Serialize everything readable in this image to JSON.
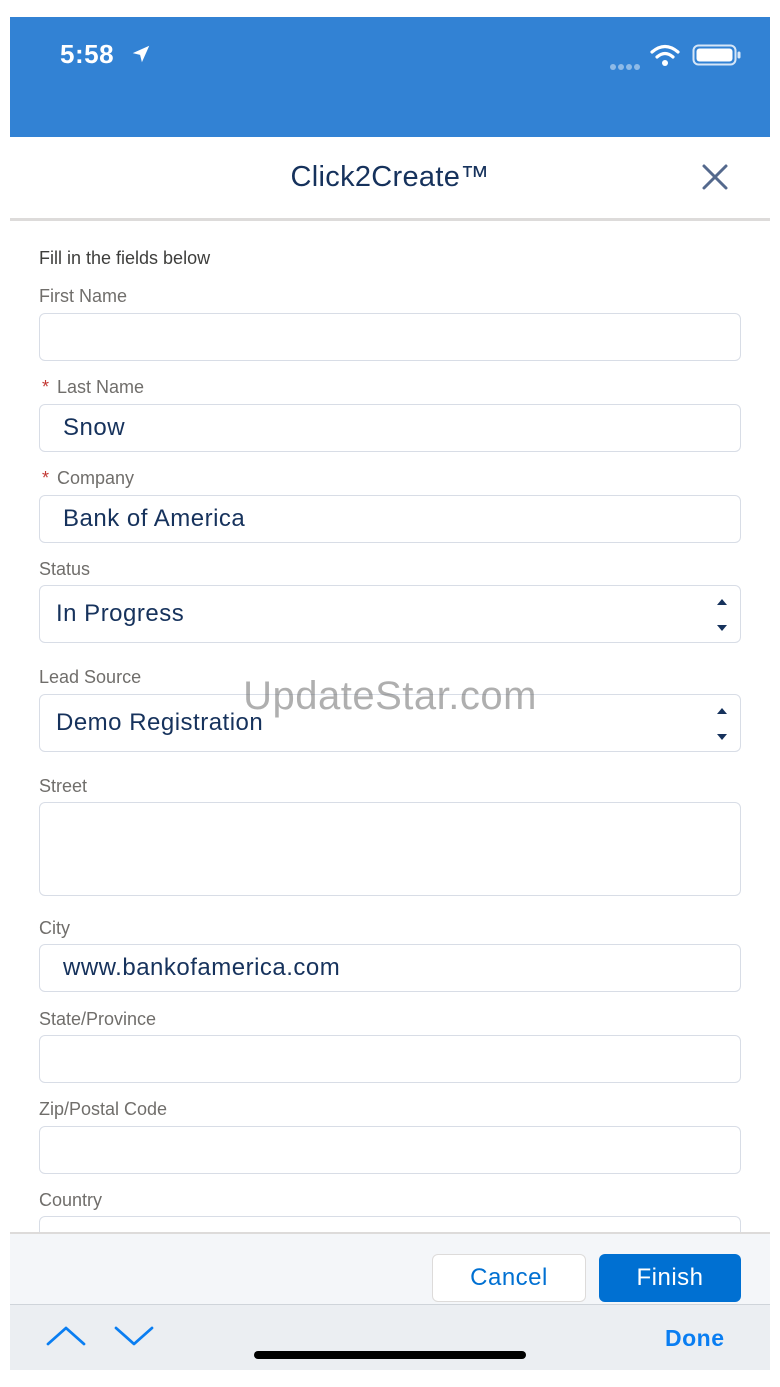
{
  "status_bar": {
    "time": "5:58"
  },
  "header": {
    "title": "Click2Create™"
  },
  "form": {
    "instructions": "Fill in the fields below",
    "required_marker": "*",
    "first_name": {
      "label": "First Name",
      "value": ""
    },
    "last_name": {
      "label": "Last Name",
      "value": "Snow"
    },
    "company": {
      "label": "Company",
      "value": "Bank of America"
    },
    "status": {
      "label": "Status",
      "value": "In Progress"
    },
    "lead_source": {
      "label": "Lead Source",
      "value": "Demo Registration"
    },
    "street": {
      "label": "Street",
      "value": ""
    },
    "city": {
      "label": "City",
      "value": "www.bankofamerica.com"
    },
    "state": {
      "label": "State/Province",
      "value": ""
    },
    "zip": {
      "label": "Zip/Postal Code",
      "value": ""
    },
    "country": {
      "label": "Country",
      "value": ""
    }
  },
  "watermark": "UpdateStar.com",
  "footer": {
    "cancel_label": "Cancel",
    "finish_label": "Finish"
  },
  "keyboard_accessory": {
    "done_label": "Done"
  },
  "colors": {
    "status_bar": "#3282d4",
    "text_primary": "#16325c",
    "brand_blue": "#0070d2",
    "required": "#c23934",
    "done_blue": "#0a7ef2"
  },
  "icons": [
    "location-arrow-icon",
    "signal-dots-icon",
    "wifi-icon",
    "battery-icon",
    "close-icon",
    "select-arrows-icon",
    "chevron-up-icon",
    "chevron-down-icon"
  ]
}
